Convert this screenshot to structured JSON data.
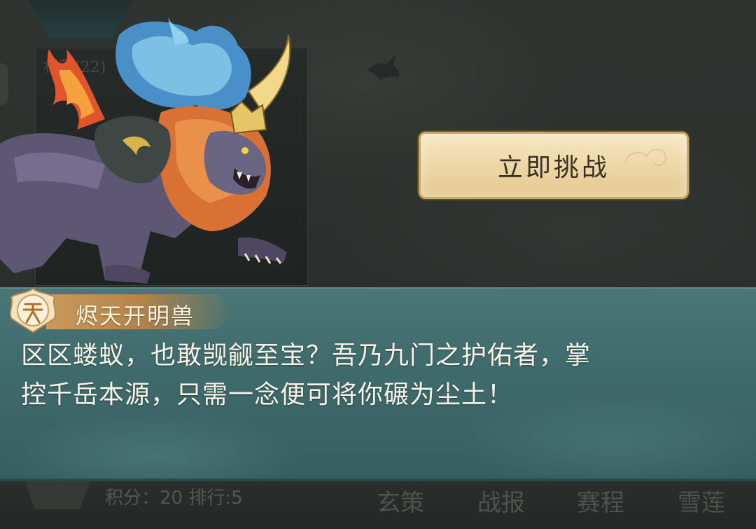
{
  "challenge_button": {
    "label": "立即挑战"
  },
  "dialog": {
    "speaker": "烬天开明兽",
    "line1": "区区蝼蚁，也敢觊觎至宝？吾乃九门之护佑者，掌",
    "line2": "控千岳本源，只需一念便可将你碾为尘土！"
  },
  "bottom_bar": {
    "score": "积分：20 排行:5",
    "nav": [
      "玄策",
      "战报",
      "赛程",
      "雪莲"
    ]
  },
  "background_label": "村落(22)",
  "colors": {
    "dialog_teal": "#3f6a6b",
    "button_gold": "#ecd6a6",
    "name_ribbon": "#c99a5a"
  },
  "icons": [
    "beast-portrait",
    "bird-silhouette",
    "tian-emblem-icon",
    "cloud-swirl"
  ]
}
